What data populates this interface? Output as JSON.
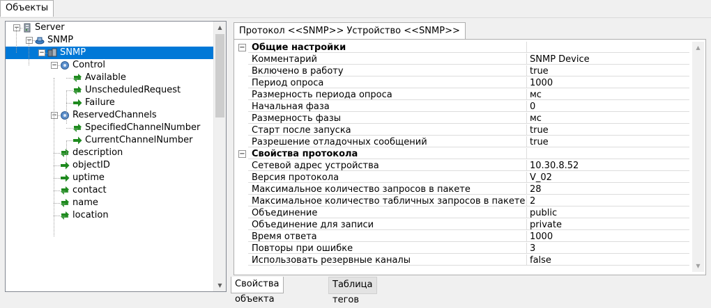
{
  "top_tab": "Объекты",
  "tree": [
    {
      "label": "Server",
      "level": 0,
      "icon": "server-icon",
      "expander": "−"
    },
    {
      "label": "SNMP",
      "level": 1,
      "icon": "snmp-module-icon",
      "expander": "−"
    },
    {
      "label": "SNMP",
      "level": 2,
      "icon": "snmp-device-icon",
      "expander": "−",
      "selected": true
    },
    {
      "label": "Control",
      "level": 3,
      "icon": "channel-group-icon",
      "expander": "−"
    },
    {
      "label": "Available",
      "level": 4,
      "icon": "tag-rw-icon"
    },
    {
      "label": "UnscheduledRequest",
      "level": 4,
      "icon": "tag-rw-icon"
    },
    {
      "label": "Failure",
      "level": 4,
      "icon": "tag-out-icon"
    },
    {
      "label": "ReservedChannels",
      "level": 3,
      "icon": "channel-group-icon",
      "expander": "−"
    },
    {
      "label": "SpecifiedChannelNumber",
      "level": 4,
      "icon": "tag-rw-icon"
    },
    {
      "label": "CurrentChannelNumber",
      "level": 4,
      "icon": "tag-out-icon"
    },
    {
      "label": "description",
      "level": 3,
      "icon": "tag-rw-icon"
    },
    {
      "label": "objectID",
      "level": 3,
      "icon": "tag-out-icon"
    },
    {
      "label": "uptime",
      "level": 3,
      "icon": "tag-out-icon"
    },
    {
      "label": "contact",
      "level": 3,
      "icon": "tag-rw-icon"
    },
    {
      "label": "name",
      "level": 3,
      "icon": "tag-rw-icon"
    },
    {
      "label": "location",
      "level": 3,
      "icon": "tag-rw-icon"
    }
  ],
  "proto_tab": "Протокол <<SNMP>> Устройство <<SNMP>>",
  "property_grid": [
    {
      "category": "Общие настройки",
      "expander": "−"
    },
    {
      "key": "Комментарий",
      "value": "SNMP Device"
    },
    {
      "key": "Включено в работу",
      "value": "true"
    },
    {
      "key": "Период опроса",
      "value": "1000"
    },
    {
      "key": "Размерность периода опроса",
      "value": "мс"
    },
    {
      "key": "Начальная фаза",
      "value": "0"
    },
    {
      "key": "Размерность фазы",
      "value": "мс"
    },
    {
      "key": "Старт после запуска",
      "value": "true"
    },
    {
      "key": "Разрешение отладочных сообщений",
      "value": "true"
    },
    {
      "category": "Свойства протокола",
      "expander": "−"
    },
    {
      "key": "Сетевой адрес устройства",
      "value": "10.30.8.52"
    },
    {
      "key": "Версия протокола",
      "value": "V_02"
    },
    {
      "key": "Максимальное количество запросов в пакете",
      "value": "28"
    },
    {
      "key": "Максимальное количество табличных запросов в пакете",
      "value": "2"
    },
    {
      "key": "Объединение",
      "value": "public"
    },
    {
      "key": "Объединение для записи",
      "value": "private"
    },
    {
      "key": "Время ответа",
      "value": "1000"
    },
    {
      "key": "Повторы при ошибке",
      "value": "3"
    },
    {
      "key": "Использовать резервные каналы",
      "value": "false"
    }
  ],
  "bottom_tabs": [
    {
      "label": "Свойства объекта",
      "active": true
    },
    {
      "label": "Таблица тегов",
      "active": false
    }
  ],
  "colors": {
    "selection": "#0078d7",
    "tag_green": "#1e8a1e"
  }
}
